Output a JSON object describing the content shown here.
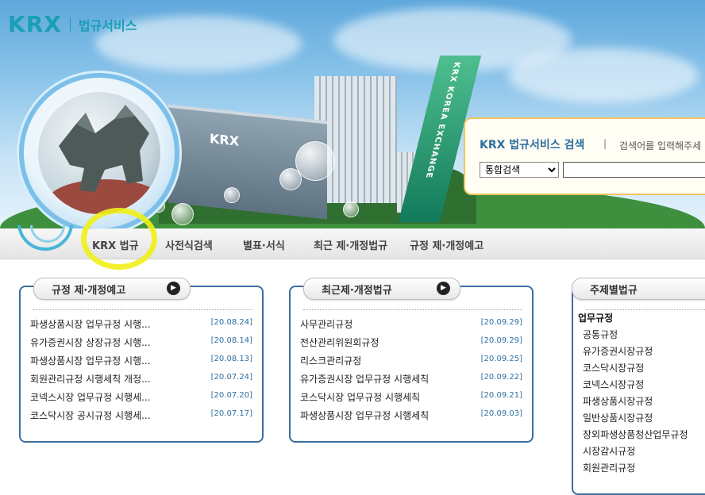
{
  "header": {
    "logo_text": "KRX",
    "service_name": "법규서비스",
    "hero_sign": "KRX",
    "pillar_text": "KRX KOREA EXCHANGE"
  },
  "search": {
    "title": "KRX 법규서비스 검색",
    "separator": "|",
    "hint": "검색어를 입력해주세",
    "select_value": "통합검색"
  },
  "nav": {
    "items": [
      "KRX 법규",
      "사전식검색",
      "별표·서식",
      "최근 제·개정법규",
      "규정 제·개정예고"
    ]
  },
  "panels": {
    "notice": {
      "title": "규정 제·개정예고",
      "arrow": "▶",
      "rows": [
        {
          "title": "파생상품시장 업무규정 시행...",
          "date": "[20.08.24]"
        },
        {
          "title": "유가증권시장 상장규정 시행...",
          "date": "[20.08.14]"
        },
        {
          "title": "파생상품시장 업무규정 시행...",
          "date": "[20.08.13]"
        },
        {
          "title": "회원관리규정 시행세칙 개정...",
          "date": "[20.07.24]"
        },
        {
          "title": "코넥스시장 업무규정 시행세...",
          "date": "[20.07.20]"
        },
        {
          "title": "코스닥시장 공시규정 시행세...",
          "date": "[20.07.17]"
        }
      ]
    },
    "recent": {
      "title": "최근제·개정법규",
      "arrow": "▶",
      "rows": [
        {
          "title": "사무관리규정",
          "date": "[20.09.29]"
        },
        {
          "title": "전산관리위원회규정",
          "date": "[20.09.29]"
        },
        {
          "title": "리스크관리규정",
          "date": "[20.09.25]"
        },
        {
          "title": "유가증권시장 업무규정 시행세칙",
          "date": "[20.09.22]"
        },
        {
          "title": "코스닥시장 업무규정 시행세칙",
          "date": "[20.09.21]"
        },
        {
          "title": "파생상품시장 업무규정 시행세칙",
          "date": "[20.09.03]"
        }
      ]
    },
    "theme": {
      "title": "주제별법규",
      "category": "업무규정",
      "items": [
        "공통규정",
        "유가증권시장규정",
        "코스닥시장규정",
        "코넥스시장규정",
        "파생상품시장규정",
        "일반상품시장규정",
        "장외파생상품청산업무규정",
        "시장감시규정",
        "회원관리규정"
      ]
    }
  },
  "colors": {
    "brand": "#1a9fb5",
    "panel_border": "#3c6fa0",
    "date": "#2f6f9f",
    "highlight": "#f1f018"
  }
}
